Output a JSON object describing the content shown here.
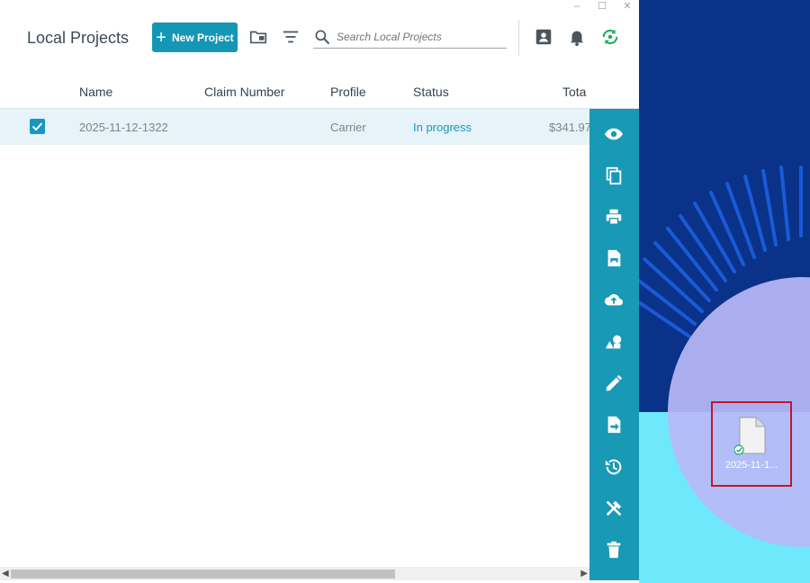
{
  "window": {
    "title": "Local Projects",
    "controls": [
      "–",
      "☐",
      "✕"
    ]
  },
  "toolbar": {
    "new_project_label": "New Project",
    "search_placeholder": "Search Local Projects",
    "icons": [
      "folder-icon",
      "filter-icon",
      "search-icon",
      "account-icon",
      "bell-icon",
      "sync-icon"
    ]
  },
  "table": {
    "headers": [
      "Name",
      "Claim Number",
      "Profile",
      "Status",
      "Tota"
    ],
    "rows": [
      {
        "name": "2025-11-12-1322",
        "claim_number": "",
        "profile": "Carrier",
        "status": "In progress",
        "total": "$341.97"
      }
    ]
  },
  "rail": {
    "icons": [
      "eye-icon",
      "copy-icon",
      "print-icon",
      "document-print-icon",
      "cloud-upload-icon",
      "shapes-icon",
      "edit-icon",
      "export-icon",
      "history-icon",
      "tools-icon",
      "trash-icon"
    ]
  },
  "desktop": {
    "file_label": "2025-11-1..."
  },
  "colors": {
    "accent": "#1696b5",
    "status": "#1c96bd",
    "sync_green": "#1fae62",
    "highlight_box": "#c0172c"
  }
}
